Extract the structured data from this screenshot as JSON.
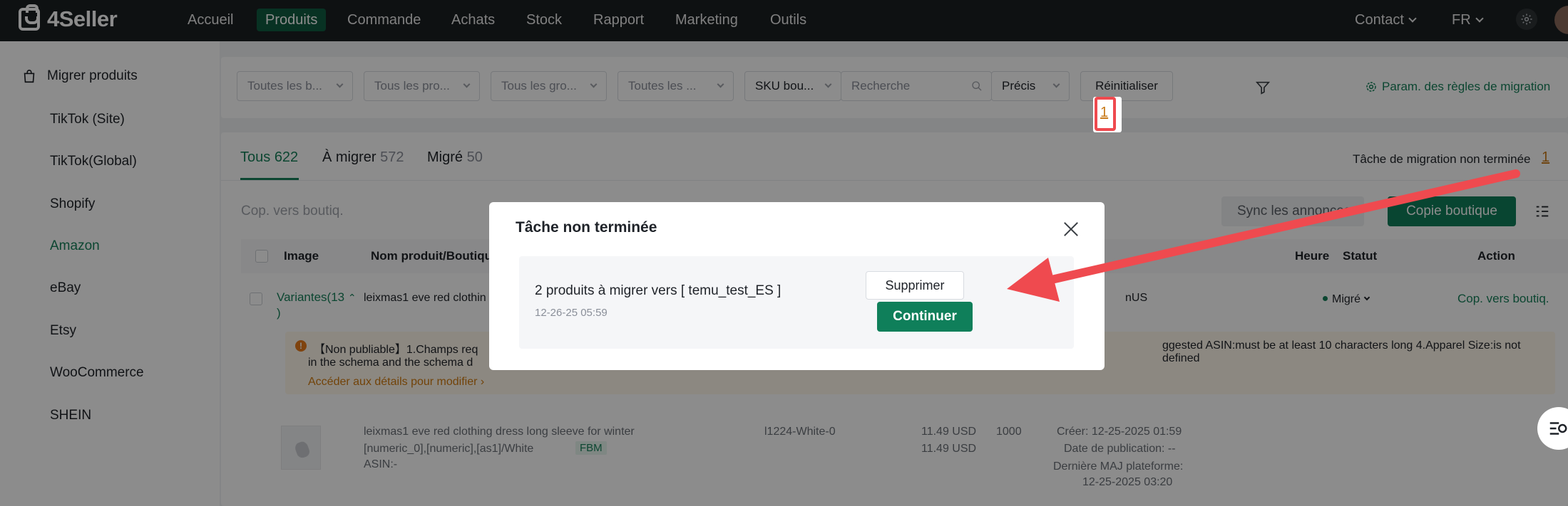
{
  "brand": {
    "name": "4Seller"
  },
  "nav": {
    "items": [
      "Accueil",
      "Produits",
      "Commande",
      "Achats",
      "Stock",
      "Rapport",
      "Marketing",
      "Outils"
    ],
    "active": "Produits",
    "contact": "Contact",
    "lang": "FR"
  },
  "sidebar": {
    "header": "Migrer produits",
    "items": [
      "TikTok (Site)",
      "TikTok(Global)",
      "Shopify",
      "Amazon",
      "eBay",
      "Etsy",
      "WooCommerce",
      "SHEIN"
    ],
    "active": "Amazon"
  },
  "filters": {
    "f1": "Toutes les b...",
    "f2": "Tous les pro...",
    "f3": "Tous les gro...",
    "f4": "Toutes les ...",
    "sku": "SKU bou...",
    "search_placeholder": "Recherche",
    "precision": "Précis",
    "reset": "Réinitialiser",
    "rules": "Param. des règles de migration"
  },
  "tabs": [
    {
      "label": "Tous",
      "count": "622"
    },
    {
      "label": "À migrer",
      "count": "572"
    },
    {
      "label": "Migré",
      "count": "50"
    }
  ],
  "task_pending": {
    "label": "Tâche de migration non terminée",
    "count": "1"
  },
  "toolbar": {
    "copy_placeholder": "Cop. vers boutiq.",
    "sync": "Sync les annonces",
    "copy_shop": "Copie boutique"
  },
  "table": {
    "headers": {
      "image": "Image",
      "name": "Nom produit/Boutique",
      "time": "Heure",
      "status": "Statut",
      "action": "Action"
    },
    "row1": {
      "variants": "Variantes(13",
      "variants_end": ")",
      "name": "leixmas1 eve red clothin",
      "shop": "nUS",
      "status": "Migré",
      "action": "Cop. vers boutiq."
    },
    "warning": {
      "line1_start": "【Non publiable】1.Champs req",
      "line1_end": "ggested ASIN:must be at least 10 characters long    4.Apparel Size:is not defined",
      "line2": "in the schema and the schema d",
      "link": "Accéder aux détails pour modifier"
    },
    "row2": {
      "name": "leixmas1 eve red clothing dress long sleeve for winter",
      "variant": "[numeric_0],[numeric],[as1]/White",
      "fbm": "FBM",
      "asin": "ASIN:-",
      "sku": "l1224-White-0",
      "price1": "11.49 USD",
      "price2": "11.49 USD",
      "qty": "1000",
      "created": "Créer: 12-25-2025 01:59",
      "published": "Date de publication: --",
      "updated_label": "Dernière MAJ plateforme:",
      "updated": "12-25-2025 03:20"
    }
  },
  "modal": {
    "title": "Tâche non terminée",
    "task_text": "2 produits à migrer vers [ temu_test_ES ]",
    "task_date": "12-26-25 05:59",
    "delete": "Supprimer",
    "continue": "Continuer"
  },
  "colors": {
    "accent": "#0f7f5a",
    "nav_bg": "#1b1f22",
    "annotation": "#ef4a4f"
  }
}
